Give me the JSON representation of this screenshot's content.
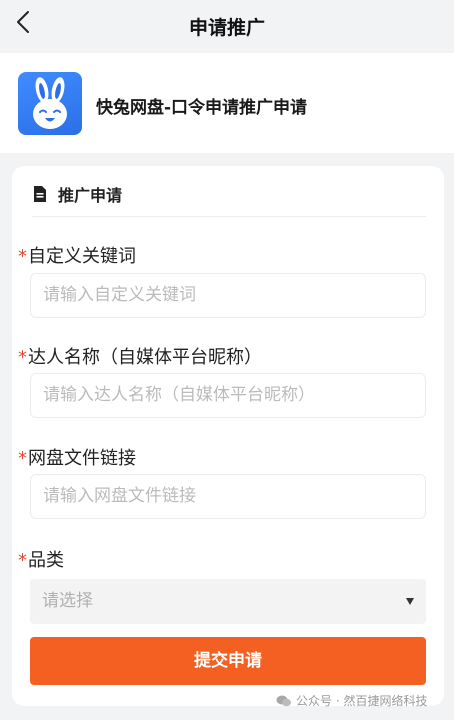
{
  "header": {
    "title": "申请推广",
    "back_icon": "chevron-left-icon"
  },
  "app": {
    "name": "快兔网盘-口令申请推广申请",
    "logo_icon": "rabbit-logo-icon",
    "logo_color": "#3b86f7"
  },
  "form": {
    "section_icon": "document-icon",
    "section_title": "推广申请",
    "required_mark": "*",
    "fields": [
      {
        "label": "自定义关键词",
        "placeholder": "请输入自定义关键词",
        "value": ""
      },
      {
        "label": "达人名称（自媒体平台昵称）",
        "placeholder": "请输入达人名称（自媒体平台昵称）",
        "value": ""
      },
      {
        "label": "网盘文件链接",
        "placeholder": "请输入网盘文件链接",
        "value": ""
      }
    ],
    "category": {
      "label": "品类",
      "placeholder": "请选择",
      "caret_icon": "triangle-down-icon"
    },
    "submit_label": "提交申请"
  },
  "watermark": {
    "text": "公众号 · 然百捷网络科技",
    "icon": "wechat-icon"
  },
  "colors": {
    "accent": "#f45f22",
    "required": "#e24a3b",
    "page_bg": "#f2f3f5"
  }
}
